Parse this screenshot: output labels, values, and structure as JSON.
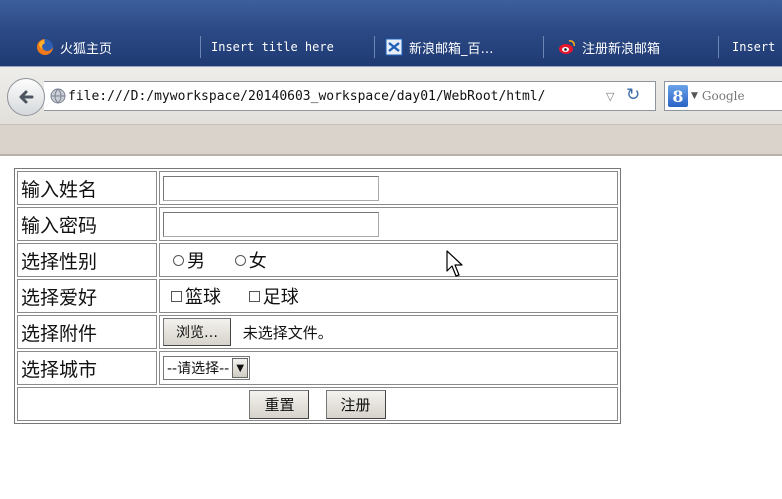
{
  "tabs": [
    {
      "label": "火狐主页",
      "icon": "firefox-icon"
    },
    {
      "label": "Insert title here",
      "icon": ""
    },
    {
      "label": "新浪邮箱_百…",
      "icon": "sina-mail-icon"
    },
    {
      "label": "注册新浪邮箱",
      "icon": "weibo-icon"
    },
    {
      "label": "Insert",
      "icon": ""
    }
  ],
  "navbar": {
    "url": "file:///D:/myworkspace/20140603_workspace/day01/WebRoot/html/",
    "search_placeholder": "Google"
  },
  "form": {
    "rows": [
      {
        "label": "输入姓名"
      },
      {
        "label": "输入密码"
      },
      {
        "label": "选择性别",
        "options": [
          "男",
          "女"
        ]
      },
      {
        "label": "选择爱好",
        "options": [
          "篮球",
          "足球"
        ]
      },
      {
        "label": "选择附件",
        "browse_button": "浏览…",
        "file_status": "未选择文件。"
      },
      {
        "label": "选择城市",
        "selected": "--请选择--"
      }
    ],
    "reset_button": "重置",
    "submit_button": "注册"
  },
  "colors": {
    "tabbar": "#2c4a86",
    "toolbar": "#d9d3cc"
  }
}
